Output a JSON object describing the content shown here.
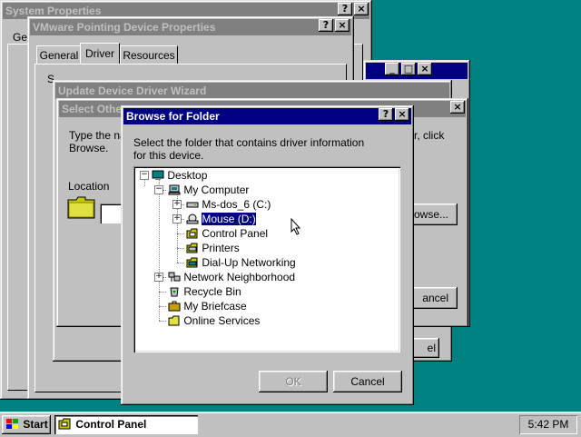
{
  "windows": {
    "system_properties": {
      "title": "System Properties",
      "tab": "Ge"
    },
    "vmware": {
      "title": "VMware Pointing Device Properties",
      "tabs": [
        "General",
        "Driver",
        "Resources"
      ],
      "partial_text": "S"
    },
    "update_wizard": {
      "title": "Update Device Driver Wizard"
    },
    "select_other": {
      "title": "Select Other",
      "instruction_left": "Type the na",
      "instruction_left2": "Browse.",
      "instruction_right": "lder, click",
      "location_label": "Location",
      "browse_button": "owse...",
      "cancel_button": "ancel",
      "back_cancel": "el"
    },
    "browse_folder": {
      "title": "Browse for Folder",
      "instruction": "Select the folder that contains driver information for this device.",
      "ok_button": "OK",
      "cancel_button": "Cancel",
      "tree": [
        {
          "label": "Desktop",
          "icon": "desktop-icon"
        },
        {
          "label": "My Computer",
          "icon": "my-computer-icon"
        },
        {
          "label": "Ms-dos_6 (C:)",
          "icon": "hard-drive-icon"
        },
        {
          "label": "Mouse (D:)",
          "icon": "cd-drive-icon",
          "selected": true
        },
        {
          "label": "Control Panel",
          "icon": "control-panel-icon"
        },
        {
          "label": "Printers",
          "icon": "printers-icon"
        },
        {
          "label": "Dial-Up Networking",
          "icon": "dial-up-icon"
        },
        {
          "label": "Network Neighborhood",
          "icon": "network-icon"
        },
        {
          "label": "Recycle Bin",
          "icon": "recycle-bin-icon"
        },
        {
          "label": "My Briefcase",
          "icon": "briefcase-icon"
        },
        {
          "label": "Online Services",
          "icon": "folder-icon"
        }
      ]
    }
  },
  "title_buttons": {
    "help": "?",
    "close": "×",
    "minimize": "_",
    "maximize": "□"
  },
  "taskbar": {
    "start_label": "Start",
    "task_label": "Control Panel",
    "clock": "5:42 PM"
  },
  "colors": {
    "desktop": "#008080",
    "active_title": "#000080",
    "inactive_title": "#808080",
    "face": "#c0c0c0"
  }
}
